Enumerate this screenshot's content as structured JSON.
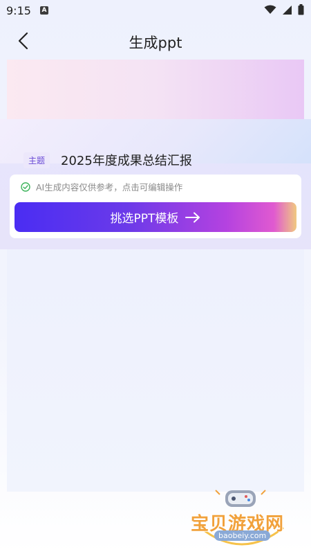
{
  "status_bar": {
    "time": "9:15",
    "notification_badge": "A",
    "icons": [
      "wifi-icon",
      "signal-icon",
      "battery-icon"
    ]
  },
  "header": {
    "back_icon": "chevron-left-icon",
    "title": "生成ppt"
  },
  "topic": {
    "tag": "主题",
    "text": "2025年度成果总结汇报"
  },
  "notice": {
    "icon": "check-circle-icon",
    "text": "AI生成内容仅供参考，点击可编辑操作"
  },
  "primary_action": {
    "label": "挑选PPT模板",
    "icon": "arrow-right-icon"
  },
  "watermark": {
    "title": "宝贝游戏网",
    "url": "baobeiy.com"
  },
  "colors": {
    "accent_start": "#4a2df3",
    "accent_end": "#e05ad0",
    "tag_text": "#6a4bd6",
    "check_green": "#3cb35a"
  }
}
